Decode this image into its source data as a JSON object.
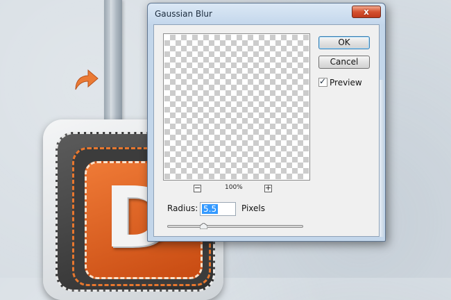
{
  "dialog": {
    "title": "Gaussian Blur",
    "ok_label": "OK",
    "cancel_label": "Cancel",
    "preview_label": "Preview",
    "preview_checked": true,
    "zoom_out_symbol": "−",
    "zoom_in_symbol": "+",
    "zoom_level": "100%",
    "radius_label": "Radius:",
    "radius_value": "5.5",
    "radius_unit": "Pixels",
    "radius_slider_fraction": 0.27,
    "close_symbol": "x",
    "check_symbol": "✓"
  },
  "background": {
    "letter": "D",
    "icons": [
      "curved-arrow-icon"
    ]
  },
  "colors": {
    "close_button": "#d5512f",
    "accent_orange": "#e8772e",
    "selection": "#3399ff",
    "titlebar": "#c4d7ec"
  }
}
